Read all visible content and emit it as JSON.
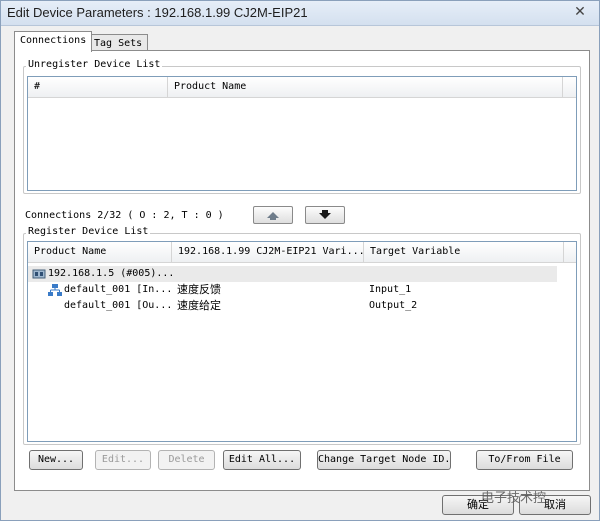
{
  "window": {
    "title": "Edit Device Parameters : 192.168.1.99 CJ2M-EIP21",
    "close": "✕"
  },
  "tabs": [
    {
      "label": "Connections"
    },
    {
      "label": "Tag Sets"
    }
  ],
  "unregister": {
    "title": "Unregister Device List",
    "columns": [
      "#",
      "Product Name"
    ]
  },
  "connections_status": "Connections 2/32 ( O : 2, T : 0 )",
  "register": {
    "title": "Register Device List",
    "columns": [
      "Product Name",
      "192.168.1.99 CJ2M-EIP21 Vari...",
      "Target Variable"
    ],
    "rows": [
      {
        "name": "192.168.1.5 (#005)...",
        "variable": "",
        "target": ""
      },
      {
        "name": "default_001 [In...",
        "variable": "速度反馈",
        "target": "Input_1"
      },
      {
        "name": "default_001 [Ou...",
        "variable": "速度给定",
        "target": "Output_2"
      }
    ]
  },
  "buttons": {
    "new": "New...",
    "edit": "Edit...",
    "delete": "Delete",
    "edit_all": "Edit All...",
    "change_target": "Change Target Node ID...",
    "to_from_file": "To/From File",
    "ok": "确定",
    "cancel": "取消"
  },
  "watermark": "电子技术控",
  "icons": {
    "device": "plc-device-icon",
    "connection": "tree-connection-icon",
    "up": "arrow-up-icon",
    "down": "arrow-down-icon"
  }
}
